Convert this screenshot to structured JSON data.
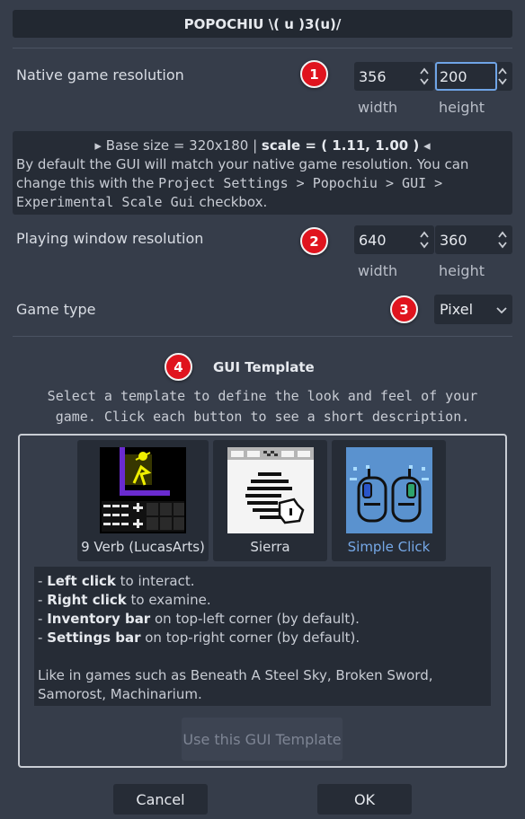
{
  "dialog": {
    "title": "POPOCHIU \\( u )3(u)/"
  },
  "native": {
    "label": "Native game resolution",
    "badge": "1",
    "width_value": "356",
    "height_value": "200",
    "width_caption": "width",
    "height_caption": "height"
  },
  "info": {
    "size_line_prefix": "▸ Base size = 320x180 |",
    "scale_text": "scale = ( 1.11, 1.00 )",
    "size_line_suffix": "◂",
    "desc_line1": "By default the GUI will match your native game resolution. You can",
    "desc_line2_prefix": "change this with the",
    "desc_line2_code": "Project Settings > Popochiu > GUI >",
    "desc_line3_code": "Experimental Scale Gui",
    "desc_line3_suffix": "checkbox."
  },
  "playing": {
    "label": "Playing window resolution",
    "badge": "2",
    "width_value": "640",
    "height_value": "360",
    "width_caption": "width",
    "height_caption": "height"
  },
  "game_type": {
    "label": "Game type",
    "badge": "3",
    "selected": "Pixel"
  },
  "gui_template": {
    "badge": "4",
    "heading": "GUI Template",
    "description_line1": "Select a template to define the look and feel of your",
    "description_line2": "game. Click each button to see a short description.",
    "templates": [
      {
        "label": "9 Verb (LucasArts)"
      },
      {
        "label": "Sierra"
      },
      {
        "label": "Simple Click"
      }
    ],
    "selected_desc": {
      "l1_bold": "Left click",
      "l1_rest": " to interact.",
      "l2_bold": "Right click",
      "l2_rest": " to examine.",
      "l3_bold": "Inventory bar",
      "l3_rest": " on top-left corner (by default).",
      "l4_bold": "Settings bar",
      "l4_rest": " on top-right corner (by default).",
      "l5": "Like in games such as Beneath A Steel Sky, Broken Sword,",
      "l6": "Samorost, Machinarium."
    },
    "use_button": "Use this GUI Template"
  },
  "footer": {
    "cancel": "Cancel",
    "ok": "OK"
  },
  "colors": {
    "background": "#363d4a",
    "field": "#262c36",
    "badge": "#e0141e",
    "accent": "#76a9e8"
  },
  "icons": {
    "spin_arrows": "updown-arrows-icon",
    "select_arrow": "chevron-updown-icon"
  }
}
